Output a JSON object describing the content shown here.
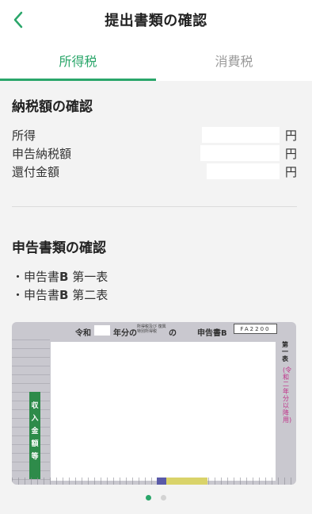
{
  "header": {
    "title": "提出書類の確認",
    "back_icon": "chevron-left-icon"
  },
  "tabs": [
    {
      "label": "所得税",
      "active": true
    },
    {
      "label": "消費税",
      "active": false
    }
  ],
  "tax_amount": {
    "title": "納税額の確認",
    "rows": [
      {
        "label": "所得",
        "unit": "円"
      },
      {
        "label": "申告納税額",
        "unit": "円"
      },
      {
        "label": "還付金額",
        "unit": "円"
      }
    ]
  },
  "documents": {
    "title": "申告書類の確認",
    "items": [
      {
        "prefix": "・申告書",
        "bold": "B",
        "suffix": " 第一表"
      },
      {
        "prefix": "・申告書",
        "bold": "B",
        "suffix": " 第二表"
      }
    ]
  },
  "preview": {
    "reiwa": "令和",
    "nen": "年分の",
    "small_text": "所得税及び 復興特別所得税",
    "no": "の",
    "shinkoku": "申告書B",
    "code": "FA2200",
    "right_label_1": "第一表",
    "right_label_2": "(令和二年分以降用)",
    "left_label": "収入金額等"
  },
  "pagination": {
    "total": 2,
    "current": 1
  },
  "colors": {
    "accent": "#2aa66a",
    "inactive": "#9a9a9a",
    "background": "#f3f3f3"
  }
}
